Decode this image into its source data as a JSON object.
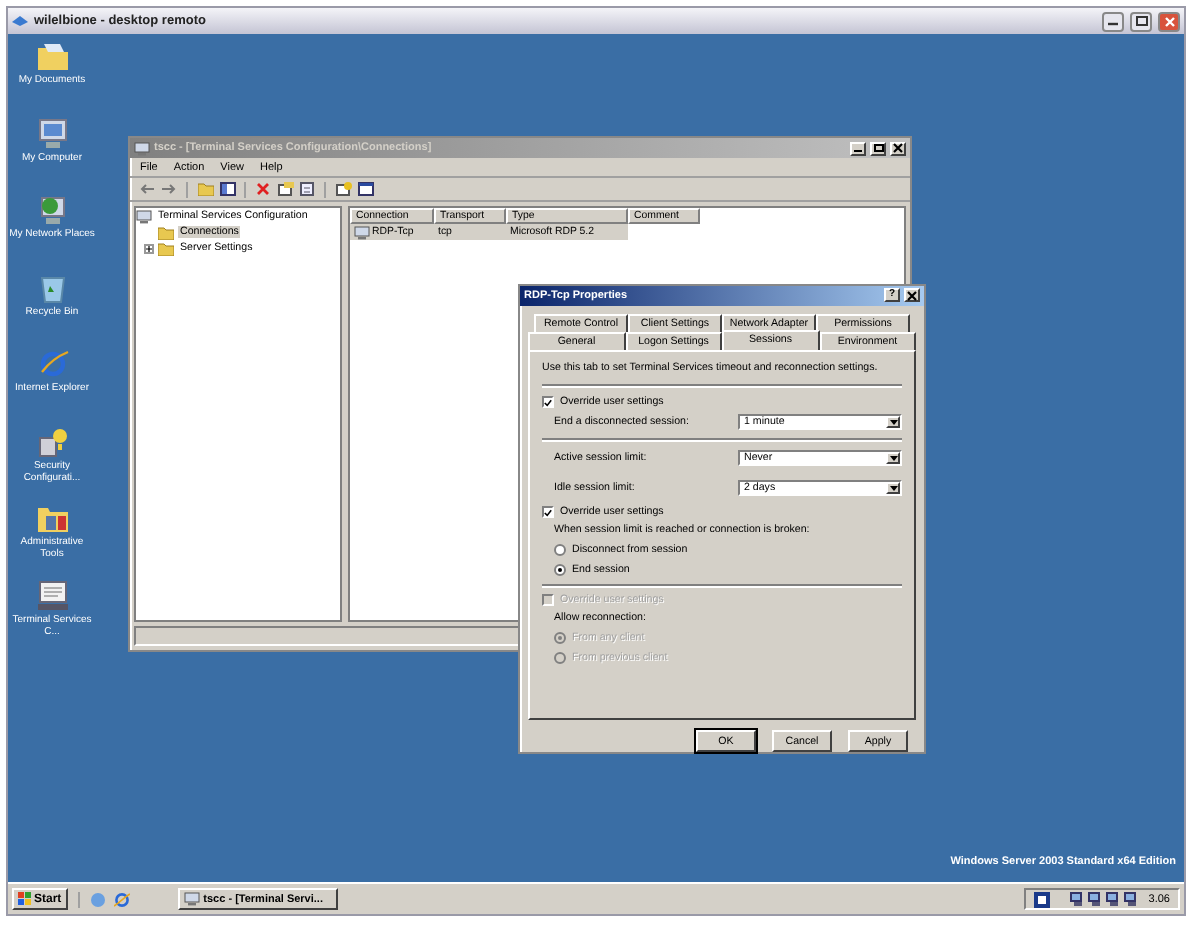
{
  "remote_window": {
    "title": "wilelbione - desktop remoto"
  },
  "desktop_icons": [
    {
      "label": "My Documents",
      "kind": "documents"
    },
    {
      "label": "My Computer",
      "kind": "computer"
    },
    {
      "label": "My Network Places",
      "kind": "network"
    },
    {
      "label": "Recycle Bin",
      "kind": "recycle"
    },
    {
      "label": "Internet Explorer",
      "kind": "browser"
    },
    {
      "label": "Security Configurati...",
      "kind": "security"
    },
    {
      "label": "Administrative Tools",
      "kind": "tools"
    },
    {
      "label": "Terminal Services C...",
      "kind": "terminal"
    }
  ],
  "mmc_window": {
    "title": "tscc - [Terminal Services Configuration\\Connections]",
    "menu": [
      "File",
      "Action",
      "View",
      "Help"
    ],
    "tree": [
      {
        "label": "Terminal Services Configuration",
        "selected": false,
        "expanded": true,
        "children": [
          {
            "label": "Connections",
            "selected": true
          },
          {
            "label": "Server Settings",
            "selected": false,
            "expanded": false
          }
        ]
      }
    ],
    "table": {
      "columns": [
        "Connection",
        "Transport",
        "Type",
        "Comment"
      ],
      "rows": [
        {
          "cells": [
            "RDP-Tcp",
            "tcp",
            "Microsoft RDP 5.2"
          ],
          "selected": true
        }
      ]
    }
  },
  "dialog": {
    "title": "RDP-Tcp Properties",
    "help_button": "?",
    "tab_rows": [
      [
        {
          "label": "Remote Control",
          "selected": false
        },
        {
          "label": "Client Settings",
          "selected": false
        },
        {
          "label": "Network Adapter",
          "selected": false
        },
        {
          "label": "Permissions",
          "selected": false
        }
      ],
      [
        {
          "label": "General",
          "selected": false
        },
        {
          "label": "Logon Settings",
          "selected": false
        },
        {
          "label": "Sessions",
          "selected": true
        },
        {
          "label": "Environment",
          "selected": false
        }
      ]
    ],
    "intro": "Use this tab to set Terminal Services timeout and reconnection settings.",
    "timeouts": {
      "override": {
        "label": "Override user settings",
        "checked": true,
        "disabled": false
      },
      "fields": [
        {
          "label": "End a disconnected session:",
          "value": "1 minute"
        },
        {
          "label": "Active session limit:",
          "value": "Never"
        },
        {
          "label": "Idle session limit:",
          "value": "2 days"
        }
      ]
    },
    "broken": {
      "override": {
        "label": "Override user settings",
        "checked": true,
        "disabled": false
      },
      "note": "When session limit is reached or connection is broken:",
      "options": [
        {
          "label": "Disconnect from session",
          "selected": false
        },
        {
          "label": "End session",
          "selected": true
        }
      ],
      "disabled": false
    },
    "reconnect": {
      "override": {
        "label": "Override user settings",
        "checked": false,
        "disabled": true
      },
      "note": "Allow reconnection:",
      "options": [
        {
          "label": "From any client",
          "selected": true
        },
        {
          "label": "From previous client",
          "selected": false
        }
      ],
      "disabled": true
    },
    "buttons": [
      "OK",
      "Cancel",
      "Apply"
    ]
  },
  "edition": "Windows Server 2003 Standard x64 Edition",
  "taskbar": {
    "start": "Start",
    "tasks": [
      {
        "label": "tscc - [Terminal Servi...",
        "selected": false
      }
    ],
    "clock": "3.06"
  }
}
